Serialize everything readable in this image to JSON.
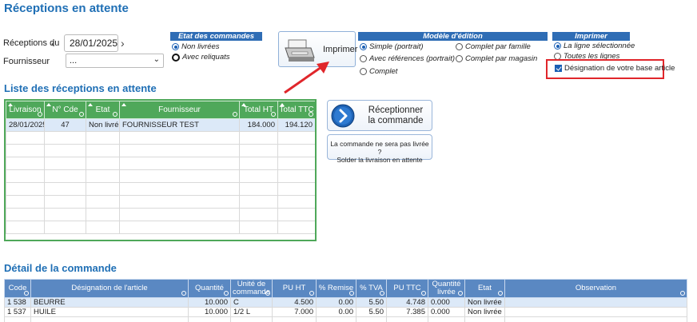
{
  "page_title": "Réceptions en attente",
  "filters": {
    "date_label": "Réceptions du",
    "date_value": "28/01/2025",
    "supplier_label": "Fournisseur",
    "supplier_value": "..."
  },
  "order_state": {
    "header": "Etat des commandes",
    "options": [
      "Non livrées",
      "Avec reliquats"
    ],
    "selected": 0
  },
  "print_button_label": "Imprimer",
  "edition_model": {
    "header": "Modèle d'édition",
    "col1": [
      "Simple (portrait)",
      "Avec références (portrait)",
      "Complet"
    ],
    "col2": [
      "Complet par famille",
      "Complet par magasin"
    ]
  },
  "print_scope": {
    "header": "Imprimer",
    "options": [
      "La ligne sélectionnée",
      "Toutes les lignes"
    ],
    "checkbox_label": "Désignation de votre base article"
  },
  "list_title": "Liste des réceptions en attente",
  "list_table": {
    "headers": [
      "Livraison",
      "N° Cde",
      "Etat",
      "Fournisseur",
      "Total HT",
      "Total TTC"
    ],
    "rows": [
      [
        "28/01/2025",
        "47",
        "Non livré",
        "FOURNISSEUR TEST",
        "184.000",
        "194.120"
      ]
    ]
  },
  "receive_button_label_1": "Réceptionner",
  "receive_button_label_2": "la commande",
  "settle_button_line1": "La commande ne sera pas livrée ?",
  "settle_button_line2": "Solder la livraison en attente",
  "detail_title": "Détail de la commande",
  "detail_table": {
    "headers": [
      "Code",
      "Désignation de l'article",
      "Quantité",
      "Unité de commande",
      "PU HT",
      "% Remise",
      "% TVA",
      "PU TTC",
      "Quantité livrée",
      "Etat",
      "Observation"
    ],
    "rows": [
      [
        "1 538",
        "BEURRE",
        "10.000",
        "C",
        "4.500",
        "0.00",
        "5.50",
        "4.748",
        "0.000",
        "Non livrée",
        ""
      ],
      [
        "1 537",
        "HUILE",
        "10.000",
        "1/2 L",
        "7.000",
        "0.00",
        "5.50",
        "7.385",
        "0.000",
        "Non livrée",
        ""
      ]
    ]
  },
  "colors": {
    "title_blue": "#1f6fb5",
    "list_header_green": "#4fa85a",
    "detail_header_blue": "#5a88c2",
    "highlight_red": "#e0262b"
  }
}
